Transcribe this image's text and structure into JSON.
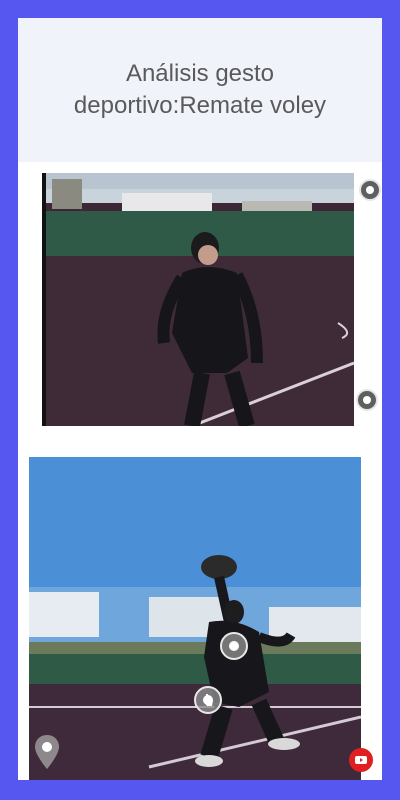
{
  "header": {
    "title": "Análisis gesto deportivo:Remate voley"
  },
  "images": [
    {
      "description": "Jugador mirando hacia arriba en una pista deportiva",
      "icon": "volleyball-player-photo"
    },
    {
      "description": "Jugador rematando el balón en la pista al atardecer",
      "icon": "volleyball-spike-photo"
    }
  ],
  "hotspots": {
    "eye_icon": "eye-icon",
    "point_icon": "circle-dot-icon",
    "hand_icon": "hand-pointer-icon",
    "location_icon": "map-pin-icon",
    "video_icon": "youtube-play-icon"
  },
  "colors": {
    "frame": "#5656f0",
    "header_bg": "#f0f4fa",
    "title": "#5a5a5a",
    "hotspot_dark": "#5f5f5f",
    "video_badge": "#e02020"
  }
}
